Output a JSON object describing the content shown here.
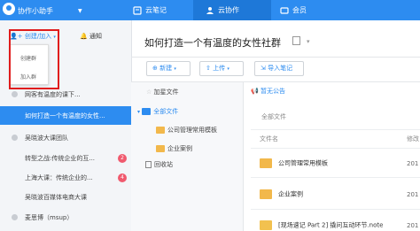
{
  "topbar": {
    "app_name": "协作小助手",
    "tabs": [
      "云笔记",
      "云协作",
      "会员"
    ]
  },
  "left": {
    "create_label": "创建/加入",
    "notify_label": "通知",
    "dropdown": [
      "创建群",
      "加入群"
    ],
    "groups": [
      {
        "label": "网客有温度的课下...",
        "badge": ""
      },
      {
        "label": "如何打造一个有温度的女性...",
        "badge": ""
      },
      {
        "label": "吴晓波大课团队",
        "badge": ""
      },
      {
        "label": "转型之战:传统企业的互...",
        "badge": "2"
      },
      {
        "label": "上海大课：传统企业的...",
        "badge": "4"
      },
      {
        "label": "吴晓波百媒体电商大课",
        "badge": ""
      },
      {
        "label": "麦思博（msup）",
        "badge": ""
      }
    ]
  },
  "main": {
    "title": "如何打造一个有温度的女性社群",
    "toolbar": {
      "new": "新建",
      "upload": "上传",
      "import": "导入笔记"
    },
    "tree": {
      "header": "加星文件",
      "all": "全部文件",
      "children": [
        "公司管理常用模板",
        "企业案例"
      ],
      "recycle": "回收站"
    },
    "notice": "暂无公告",
    "breadcrumb": "全部文件",
    "columns": {
      "name": "文件名",
      "modified": "修改"
    },
    "files": [
      {
        "name": "公司管理常用模板",
        "date": "201"
      },
      {
        "name": "企业案例",
        "date": "201"
      },
      {
        "name": "[现场速记 Part 2] 撬问互动环节.note",
        "date": "201"
      }
    ]
  }
}
